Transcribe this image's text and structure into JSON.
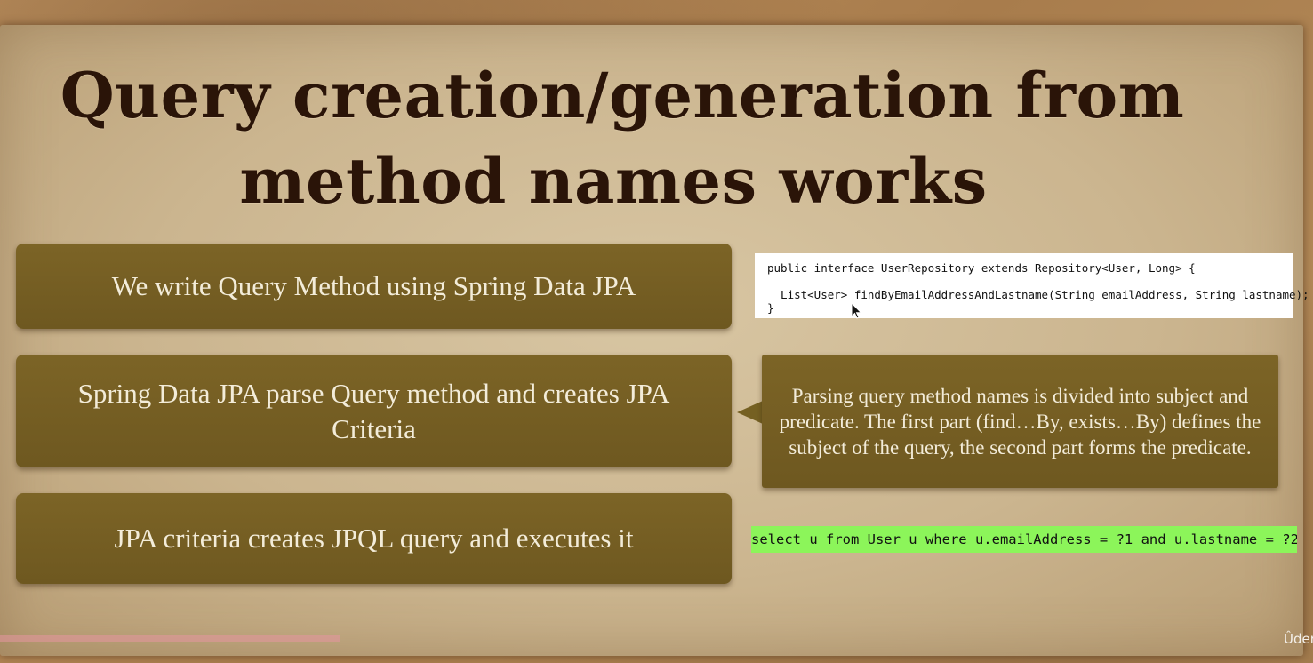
{
  "slide": {
    "title_line1": "Query creation/generation from",
    "title_line2": "method names works",
    "steps": [
      "We write Query Method using Spring Data JPA",
      "Spring Data JPA parse Query method and creates JPA Criteria",
      "JPA criteria creates JPQL query and executes it"
    ],
    "code_lines": [
      "public interface UserRepository extends Repository<User, Long> {",
      "",
      "  List<User> findByEmailAddressAndLastname(String emailAddress, String lastname);",
      "}"
    ],
    "callout": "Parsing query method names is divided into subject and predicate. The first part (find…By, exists…By) defines the subject of the query, the second part forms the predicate.",
    "sql": "select u from User u where u.emailAddress = ?1 and u.lastname = ?2"
  },
  "player": {
    "progress_fraction": 0.26,
    "watermark": "Ûder"
  },
  "colors": {
    "box": "#766022",
    "box_text": "#f3ecd9",
    "title": "#2a1408",
    "sql_highlight": "#8cf55a",
    "paper": "#d4c19d"
  }
}
